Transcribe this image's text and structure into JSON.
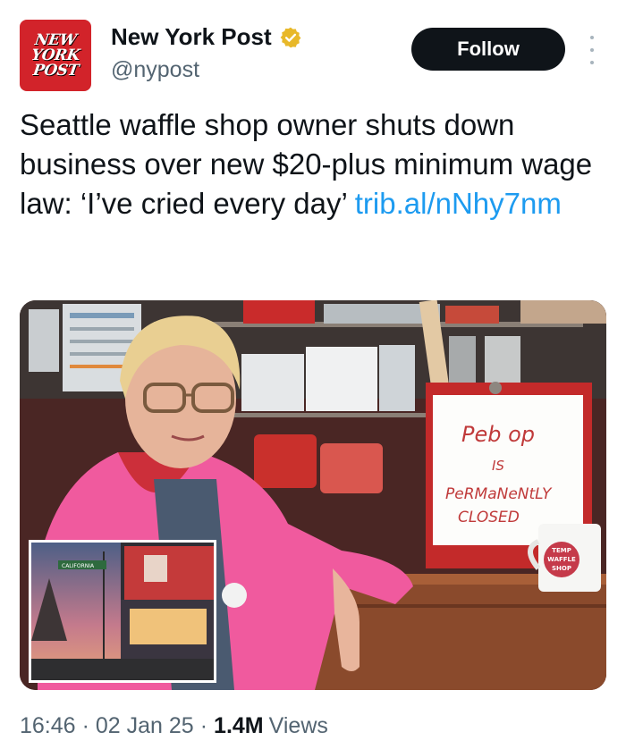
{
  "account": {
    "avatar_lines": [
      "NEW",
      "YORK",
      "POST"
    ],
    "name": "New York Post",
    "handle": "@nypost",
    "verified_icon": "verified-badge-gold"
  },
  "actions": {
    "follow_label": "Follow",
    "more_icon": "more-vertical-icon"
  },
  "tweet": {
    "text": "Seattle waffle shop owner shuts down business over new $20-plus minimum wage law: ‘I’ve cried every day’ ",
    "link": "trib.al/nNhy7nm"
  },
  "media": {
    "sign_lines": [
      "Peb op",
      "IS",
      "PeRMaNeNtLY",
      "CLOSED"
    ],
    "mug_text": [
      "TEMP",
      "WAFFLE",
      "SHOP"
    ],
    "street_sign": "CALIFORNIA"
  },
  "meta": {
    "time": "16:46",
    "date": "02 Jan 25",
    "views_count": "1.4M",
    "views_label": "Views",
    "separator": "·"
  },
  "colors": {
    "brand_red": "#d2232a",
    "link_blue": "#1d9bf0",
    "secondary_text": "#536471",
    "follow_bg": "#0f1419"
  }
}
